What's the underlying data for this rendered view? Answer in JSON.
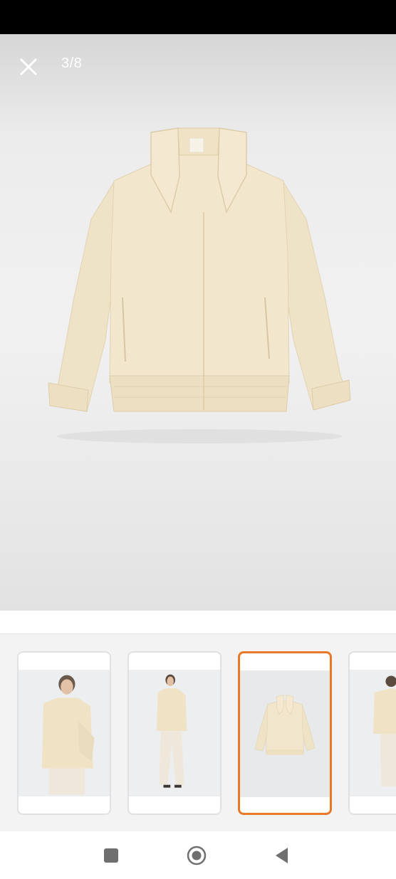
{
  "viewer": {
    "counter": "3/8",
    "close_icon": "close-icon"
  },
  "main_image": {
    "subject": "cream-bomber-jacket-flat"
  },
  "thumbnails": [
    {
      "subject": "model-jacket-closeup",
      "selected": false
    },
    {
      "subject": "model-full-length",
      "selected": false
    },
    {
      "subject": "jacket-flat",
      "selected": true
    },
    {
      "subject": "model-back-view",
      "selected": false
    }
  ],
  "nav_bar": {
    "icons": [
      "recent-apps-icon",
      "home-icon",
      "back-icon"
    ]
  },
  "colors": {
    "accent": "#e8782a",
    "jacket": "#f1e6cc"
  }
}
